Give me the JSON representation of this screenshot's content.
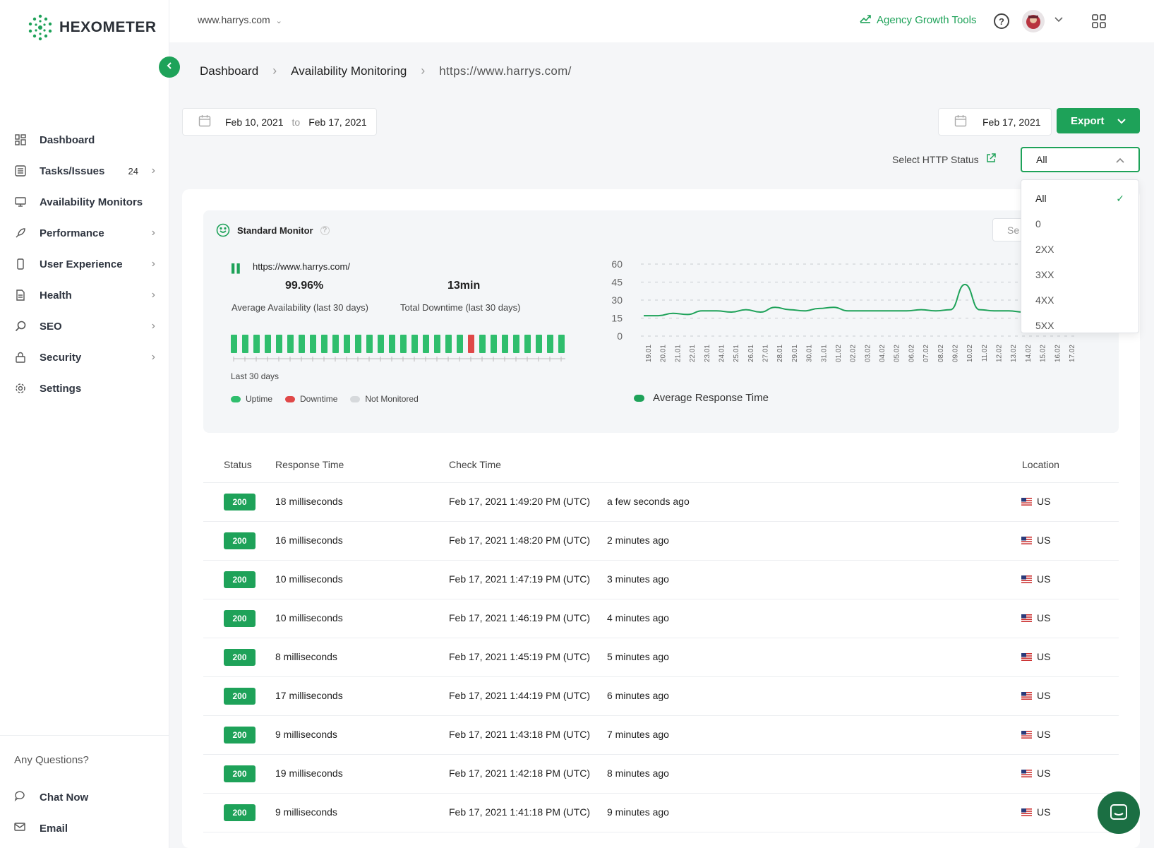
{
  "brand": {
    "name": "HEXOMETER"
  },
  "topbar": {
    "site": "www.harrys.com",
    "agency_label": "Agency Growth Tools",
    "icons": {
      "help": "help-circle-icon",
      "apps": "grid-icon",
      "chevron": "chevron-down-icon"
    }
  },
  "sidebar": {
    "items": [
      {
        "label": "Dashboard",
        "icon": "dashboard-icon"
      },
      {
        "label": "Tasks/Issues",
        "count": "24",
        "icon": "tasks-icon"
      },
      {
        "label": "Availability Monitors",
        "icon": "monitor-icon"
      },
      {
        "label": "Performance",
        "icon": "rocket-icon"
      },
      {
        "label": "User Experience",
        "icon": "mobile-icon"
      },
      {
        "label": "Health",
        "icon": "document-icon"
      },
      {
        "label": "SEO",
        "icon": "search-icon"
      },
      {
        "label": "Security",
        "icon": "lock-icon"
      },
      {
        "label": "Settings",
        "icon": "gear-icon"
      }
    ],
    "questions": "Any Questions?",
    "chat": "Chat Now",
    "email": "Email"
  },
  "breadcrumb": [
    "Dashboard",
    "Availability Monitoring",
    "https://www.harrys.com/"
  ],
  "filters": {
    "from": "Feb 10, 2021",
    "to_word": "to",
    "to": "Feb 17, 2021",
    "date": "Feb 17, 2021",
    "export": "Export",
    "http_label": "Select HTTP Status",
    "http_value": "All",
    "http_options": [
      "All",
      "0",
      "2XX",
      "3XX",
      "4XX",
      "5XX"
    ]
  },
  "monitor": {
    "title": "Standard Monitor",
    "set_label": "Se",
    "url": "https://www.harrys.com/",
    "availability": "99.96%",
    "availability_label": "Average Availability (last 30 days)",
    "downtime": "13min",
    "downtime_label": "Total Downtime (last 30 days)",
    "last30": "Last 30 days",
    "legend": {
      "uptime": "Uptime",
      "downtime": "Downtime",
      "not_monitored": "Not Monitored"
    },
    "daily_status": [
      "up",
      "up",
      "up",
      "up",
      "up",
      "up",
      "up",
      "up",
      "up",
      "up",
      "up",
      "up",
      "up",
      "up",
      "up",
      "up",
      "up",
      "up",
      "up",
      "up",
      "up",
      "down",
      "up",
      "up",
      "up",
      "up",
      "up",
      "up",
      "up",
      "up"
    ]
  },
  "colors": {
    "accent": "#1ea259",
    "uptime": "#2fbe6d",
    "downtime": "#e04848",
    "not_monitored": "#d6d9dc"
  },
  "chart_data": {
    "type": "line",
    "title": "",
    "series": [
      {
        "name": "Average Response Time",
        "values": [
          17,
          17,
          19,
          18,
          21,
          21,
          20,
          22,
          20,
          24,
          22,
          21,
          23,
          24,
          21,
          21,
          21,
          21,
          21,
          22,
          21,
          22,
          43,
          22,
          21,
          21,
          20,
          21,
          22,
          22
        ]
      }
    ],
    "x": [
      "19.01",
      "20.01",
      "21.01",
      "22.01",
      "23.01",
      "24.01",
      "25.01",
      "26.01",
      "27.01",
      "28.01",
      "29.01",
      "30.01",
      "31.01",
      "01.02",
      "02.02",
      "03.02",
      "04.02",
      "05.02",
      "06.02",
      "07.02",
      "08.02",
      "09.02",
      "10.02",
      "11.02",
      "12.02",
      "13.02",
      "14.02",
      "15.02",
      "16.02",
      "17.02"
    ],
    "y_ticks": [
      60,
      45,
      30,
      15,
      0
    ],
    "ylim": [
      0,
      60
    ],
    "grid": true,
    "legend_position": "bottom-left"
  },
  "table": {
    "headers": {
      "status": "Status",
      "response": "Response Time",
      "check": "Check Time",
      "location": "Location"
    },
    "rows": [
      {
        "status": "200",
        "response": "18 milliseconds",
        "time": "Feb 17, 2021 1:49:20 PM (UTC)",
        "ago": "a few seconds ago",
        "location": "US"
      },
      {
        "status": "200",
        "response": "16 milliseconds",
        "time": "Feb 17, 2021 1:48:20 PM (UTC)",
        "ago": "2 minutes ago",
        "location": "US"
      },
      {
        "status": "200",
        "response": "10 milliseconds",
        "time": "Feb 17, 2021 1:47:19 PM (UTC)",
        "ago": "3 minutes ago",
        "location": "US"
      },
      {
        "status": "200",
        "response": "10 milliseconds",
        "time": "Feb 17, 2021 1:46:19 PM (UTC)",
        "ago": "4 minutes ago",
        "location": "US"
      },
      {
        "status": "200",
        "response": "8 milliseconds",
        "time": "Feb 17, 2021 1:45:19 PM (UTC)",
        "ago": "5 minutes ago",
        "location": "US"
      },
      {
        "status": "200",
        "response": "17 milliseconds",
        "time": "Feb 17, 2021 1:44:19 PM (UTC)",
        "ago": "6 minutes ago",
        "location": "US"
      },
      {
        "status": "200",
        "response": "9 milliseconds",
        "time": "Feb 17, 2021 1:43:18 PM (UTC)",
        "ago": "7 minutes ago",
        "location": "US"
      },
      {
        "status": "200",
        "response": "19 milliseconds",
        "time": "Feb 17, 2021 1:42:18 PM (UTC)",
        "ago": "8 minutes ago",
        "location": "US"
      },
      {
        "status": "200",
        "response": "9 milliseconds",
        "time": "Feb 17, 2021 1:41:18 PM (UTC)",
        "ago": "9 minutes ago",
        "location": "US"
      }
    ]
  }
}
